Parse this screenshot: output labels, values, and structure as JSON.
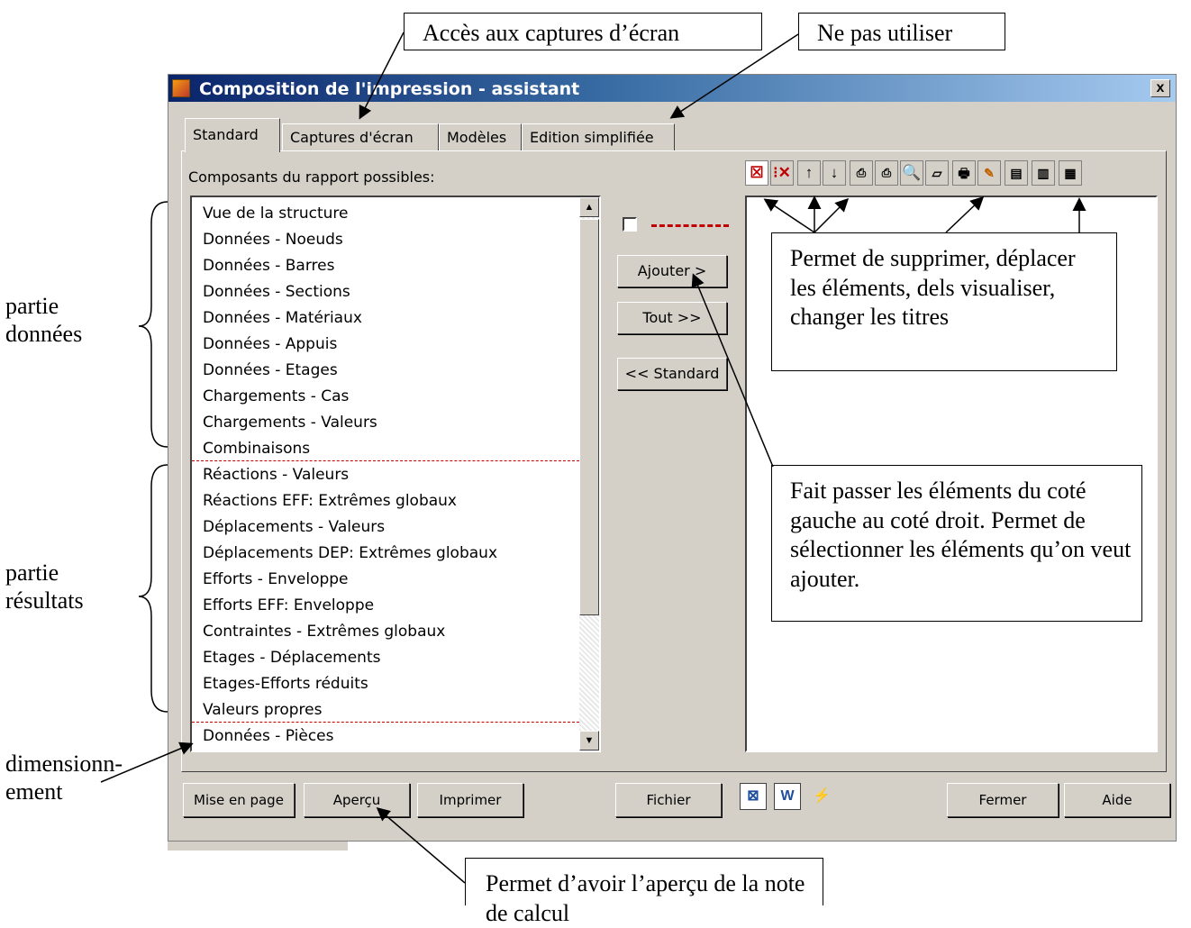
{
  "annotations": {
    "captures_callout": "Accès aux captures d’écran",
    "ne_pas_utiliser_callout": "Ne pas utiliser",
    "toolbar_callout": "Permet de supprimer, déplacer les éléments, dels visualiser, changer les titres",
    "ajouter_callout": "Fait passer les éléments du coté gauche au coté droit. Permet de sélectionner les éléments qu’on veut ajouter.",
    "apercu_callout": "Permet d’avoir l’aperçu de la note de calcul",
    "partie_donnees": "partie données",
    "partie_resultats": "partie résultats",
    "dimensionnement": "dimensionn- ement"
  },
  "dialog": {
    "title": "Composition de l'impression - assistant",
    "close_label": "x",
    "tabs": [
      "Standard",
      "Captures d'écran",
      "Modèles",
      "Edition simplifiée"
    ],
    "components_label": "Composants du rapport possibles:",
    "left_list": [
      "Vue de la structure",
      "Données - Noeuds",
      "Données - Barres",
      "Données - Sections",
      "Données - Matériaux",
      "Données - Appuis",
      "Données - Etages",
      "Chargements - Cas",
      "Chargements - Valeurs",
      "Combinaisons",
      "Réactions - Valeurs",
      "Réactions EFF: Extrêmes globaux",
      "Déplacements - Valeurs",
      "Déplacements DEP: Extrêmes globaux",
      "Efforts - Enveloppe",
      "Efforts EFF: Enveloppe",
      "Contraintes - Extrêmes globaux",
      "Etages - Déplacements",
      "Etages-Efforts réduits",
      "Valeurs propres",
      "Données - Pièces"
    ],
    "middle_buttons": {
      "ajouter": "Ajouter >",
      "tout": "Tout >>",
      "standard": "<< Standard"
    },
    "toolbar_icons": [
      "delete-icon",
      "delete-all-icon",
      "arrow-up-icon",
      "arrow-down-icon",
      "print-options-icon",
      "print-options-2-icon",
      "preview-icon",
      "title-icon",
      "print-icon",
      "edit-icon",
      "page-layout-1-icon",
      "page-layout-2-icon",
      "page-layout-3-icon"
    ],
    "bottom_buttons": {
      "mise_en_page": "Mise en page",
      "apercu": "Aperçu",
      "imprimer": "Imprimer",
      "fichier": "Fichier",
      "fermer": "Fermer",
      "aide": "Aide"
    }
  }
}
